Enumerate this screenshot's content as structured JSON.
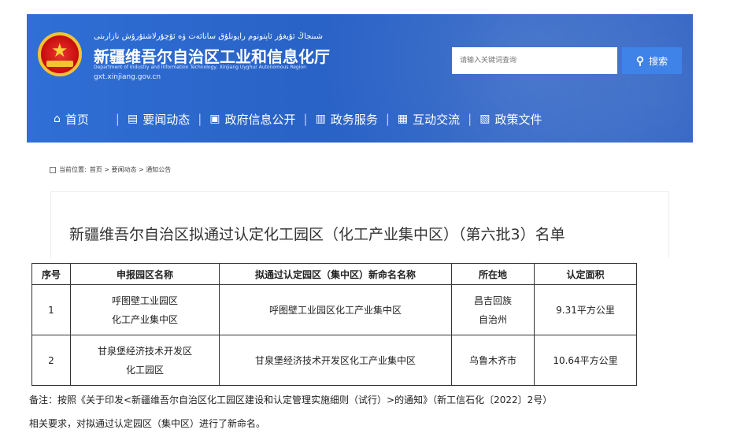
{
  "header": {
    "uy_line": "شىنجاڭ ئۇيغۇر ئاپتونوم رايونلۇق سانائەت ۋە ئۇچۇرلاشتۇرۇش نازارىتى",
    "title": "新疆维吾尔自治区工业和信息化厅",
    "en_line": "Department of Industry and Information Technology, Xinjiang Uyghur Autonomous Region",
    "url": "gxt.xinjiang.gov.cn",
    "search_placeholder": "请输入关键词查询",
    "search_label": "搜索"
  },
  "nav": [
    {
      "icon": "home-icon",
      "label": "首页"
    },
    {
      "icon": "news-icon",
      "label": "要闻动态"
    },
    {
      "icon": "info-icon",
      "label": "政府信息公开"
    },
    {
      "icon": "service-icon",
      "label": "政务服务"
    },
    {
      "icon": "chat-icon",
      "label": "互动交流"
    },
    {
      "icon": "policy-icon",
      "label": "政策文件"
    }
  ],
  "breadcrumb": {
    "label": "当前位置:",
    "path": "首页 > 要闻动态 > 通知公告"
  },
  "document": {
    "title": "新疆维吾尔自治区拟通过认定化工园区（化工产业集中区）（第六批3）名单"
  },
  "table": {
    "headers": [
      "序号",
      "申报园区名称",
      "拟通过认定园区（集中区）新命名名称",
      "所在地",
      "认定面积"
    ],
    "rows": [
      {
        "no": "1",
        "name_a": "呼图壁工业园区",
        "name_b": "化工产业集中区",
        "new_name": "呼图壁工业园区化工产业集中区",
        "loc_a": "昌吉回族",
        "loc_b": "自治州",
        "area": "9.31平方公里"
      },
      {
        "no": "2",
        "name_a": "甘泉堡经济技术开发区",
        "name_b": "化工园区",
        "new_name": "甘泉堡经济技术开发区化工产业集中区",
        "loc_a": "乌鲁木齐市",
        "loc_b": "",
        "area": "10.64平方公里"
      }
    ]
  },
  "note": {
    "line1": "备注：按照《关于印发<新疆维吾尔自治区化工园区建设和认定管理实施细则（试行）>的通知》（新工信石化〔2022〕2号）",
    "line2": "相关要求，对拟通过认定园区（集中区）进行了新命名。"
  },
  "colors": {
    "header_blue": "#2f6fd6",
    "search_button": "#3f82e8"
  }
}
